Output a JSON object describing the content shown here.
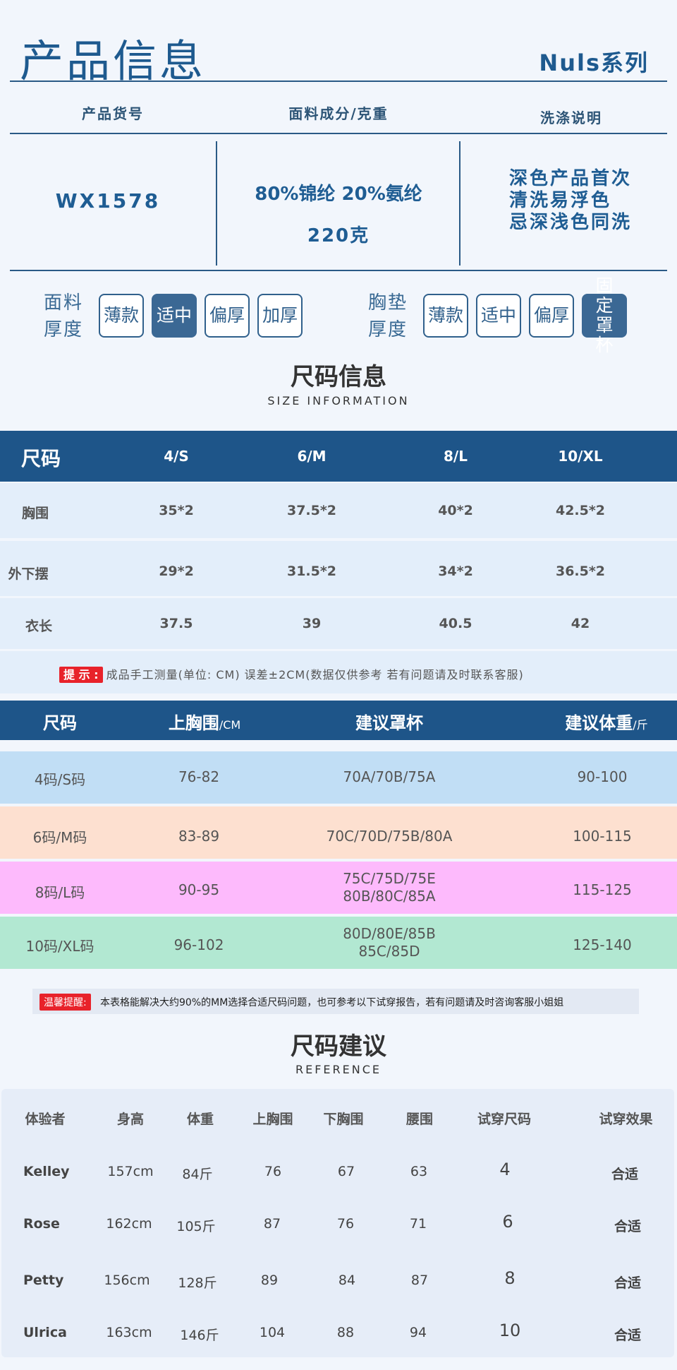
{
  "header": {
    "title": "产品信息",
    "series": "Nuls系列"
  },
  "info": {
    "col_code": "产品货号",
    "col_fabric": "面料成分/克重",
    "col_wash": "洗涤说明",
    "code": "WX1578",
    "fabric": "80%锦纶  20%氨纶",
    "weight": "220克",
    "wash": [
      "深色产品首次",
      "清洗易浮色",
      "忌深浅色同洗"
    ]
  },
  "thickness": {
    "fabric_label": [
      "面料",
      "厚度"
    ],
    "fabric_options": [
      "薄款",
      "适中",
      "偏厚",
      "加厚"
    ],
    "fabric_selected": "适中",
    "pad_label": [
      "胸垫",
      "厚度"
    ],
    "pad_options": [
      "薄款",
      "适中",
      "偏厚",
      "固定罩杯"
    ],
    "pad_selected": "固定罩杯"
  },
  "size_section": {
    "title": "尺码信息",
    "subtitle": "SIZE INFORMATION"
  },
  "size_table": {
    "header": [
      "尺码",
      "4/S",
      "6/M",
      "8/L",
      "10/XL"
    ],
    "rows": [
      [
        "胸围",
        "35*2",
        "37.5*2",
        "40*2",
        "42.5*2"
      ],
      [
        "外下摆",
        "29*2",
        "31.5*2",
        "34*2",
        "36.5*2"
      ],
      [
        "衣长",
        "37.5",
        "39",
        "40.5",
        "42"
      ]
    ],
    "tip_tag": "提 示 :",
    "tip_text": "成品手工测量(单位: CM) 误差±2CM(数据仅供参考   若有问题请及时联系客服)"
  },
  "recommend_table": {
    "header": [
      "尺码",
      "上胸围",
      "/CM",
      "建议罩杯",
      "建议体重",
      "/斤"
    ],
    "rows": [
      {
        "size": "4码/S码",
        "bust": "76-82",
        "cup": [
          "70A/70B/75A"
        ],
        "weight": "90-100",
        "color": "#c1def5"
      },
      {
        "size": "6码/M码",
        "bust": "83-89",
        "cup": [
          "70C/70D/75B/80A"
        ],
        "weight": "100-115",
        "color": "#fde0d0"
      },
      {
        "size": "8码/L码",
        "bust": "90-95",
        "cup": [
          "75C/75D/75E",
          "80B/80C/85A"
        ],
        "weight": "115-125",
        "color": "#fdbafc"
      },
      {
        "size": "10码/XL码",
        "bust": "96-102",
        "cup": [
          "80D/80E/85B",
          "85C/85D"
        ],
        "weight": "125-140",
        "color": "#b2e8d2"
      }
    ],
    "note_tag": "温馨提醒:",
    "note_text": "本表格能解决大约90%的MM选择合适尺码问题，也可参考以下试穿报告，若有问题请及时咨询客服小姐姐"
  },
  "ref_section": {
    "title": "尺码建议",
    "subtitle": "REFERENCE"
  },
  "ref_table": {
    "header": [
      "体验者",
      "身高",
      "体重",
      "上胸围",
      "下胸围",
      "腰围",
      "试穿尺码",
      "试穿效果"
    ],
    "rows": [
      [
        "Kelley",
        "157cm",
        "84斤",
        "76",
        "67",
        "63",
        "4",
        "合适"
      ],
      [
        "Rose",
        "162cm",
        "105斤",
        "87",
        "76",
        "71",
        "6",
        "合适"
      ],
      [
        "Petty",
        "156cm",
        "128斤",
        "89",
        "84",
        "87",
        "8",
        "合适"
      ],
      [
        "Ulrica",
        "163cm",
        "146斤",
        "104",
        "88",
        "94",
        "10",
        "合适"
      ]
    ]
  }
}
